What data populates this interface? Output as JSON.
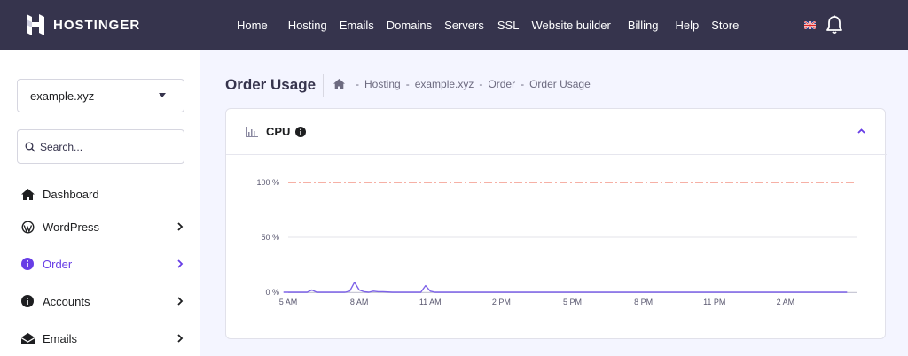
{
  "brand": {
    "name": "HOSTINGER"
  },
  "nav": {
    "items": [
      "Home",
      "Hosting",
      "Emails",
      "Domains",
      "Servers",
      "SSL",
      "Website builder",
      "Billing",
      "Help",
      "Store"
    ]
  },
  "sidebar": {
    "domain": "example.xyz",
    "search_placeholder": "Search...",
    "items": [
      {
        "label": "Dashboard",
        "icon": "home-icon",
        "chevron": false,
        "active": false
      },
      {
        "label": "WordPress",
        "icon": "wordpress-icon",
        "chevron": true,
        "active": false
      },
      {
        "label": "Order",
        "icon": "info-icon",
        "chevron": true,
        "active": true
      },
      {
        "label": "Accounts",
        "icon": "info-icon",
        "chevron": true,
        "active": false
      },
      {
        "label": "Emails",
        "icon": "mail-icon",
        "chevron": true,
        "active": false
      }
    ]
  },
  "page": {
    "title": "Order Usage",
    "breadcrumb": [
      "Hosting",
      "example.xyz",
      "Order",
      "Order Usage"
    ]
  },
  "card": {
    "title": "CPU"
  },
  "colors": {
    "accent": "#673de6",
    "topbar": "#36344d",
    "limit_line": "#f0806f",
    "series": "#7e63e8"
  },
  "chart_data": {
    "type": "line",
    "x_ticks": [
      "5 AM",
      "8 AM",
      "11 AM",
      "2 PM",
      "5 PM",
      "8 PM",
      "11 PM",
      "2 AM"
    ],
    "y_ticks": [
      "0 %",
      "50 %",
      "100 %"
    ],
    "ylim": [
      0,
      100
    ],
    "limit_value": 100,
    "x_hours": [
      4.8,
      5.8,
      6.0,
      6.2,
      7.4,
      7.6,
      7.8,
      8.0,
      8.2,
      8.4,
      8.6,
      8.8,
      9.0,
      9.4,
      9.8,
      10.6,
      10.8,
      11.0,
      11.2,
      11.4,
      14.0,
      17.0,
      20.0,
      23.0,
      26.0,
      28.6
    ],
    "values": [
      0,
      0,
      2,
      0,
      0,
      1,
      9,
      2,
      0.5,
      0,
      1,
      0.5,
      0.5,
      0,
      0,
      0,
      6,
      1,
      0,
      0,
      0,
      0,
      0,
      0,
      0,
      0
    ]
  }
}
